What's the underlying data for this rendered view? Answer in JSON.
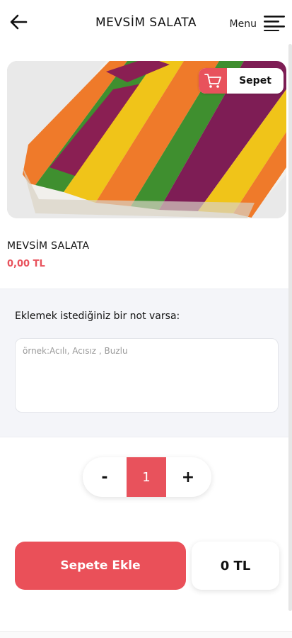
{
  "header": {
    "title": "MEVSİM SALATA",
    "menu_label": "Menu",
    "back_icon": "arrow-left-icon",
    "menu_icon": "hamburger-icon"
  },
  "cart": {
    "label": "Sepet",
    "icon": "cart-icon",
    "accent": "#e8525c"
  },
  "product": {
    "name": "MEVSİM SALATA",
    "price": "0,00 TL"
  },
  "note": {
    "label": "Eklemek istediğiniz bir not varsa:",
    "placeholder": "örnek:Acılı, Acısız , Buzlu",
    "value": ""
  },
  "quantity": {
    "minus": "-",
    "value": "1",
    "plus": "+"
  },
  "actions": {
    "add_to_cart": "Sepete Ekle",
    "total": "0 TL"
  },
  "colors": {
    "accent": "#e8525c",
    "section_bg": "#f4f5f9"
  }
}
